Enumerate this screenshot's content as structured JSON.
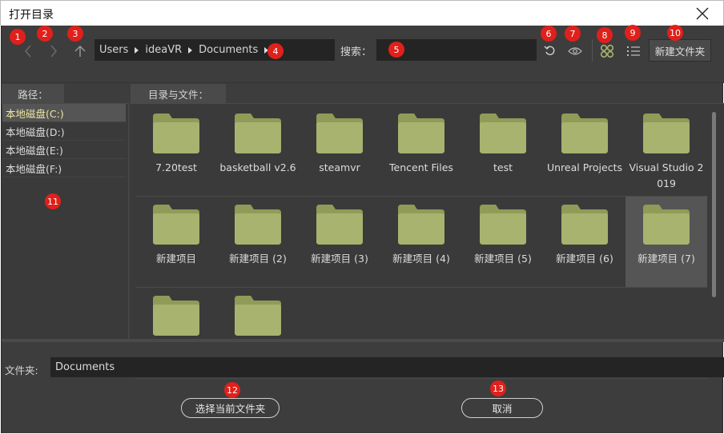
{
  "window": {
    "title": "打开目录"
  },
  "toolbar": {
    "back_icon": "chevron-left-icon",
    "forward_icon": "chevron-right-icon",
    "up_icon": "arrow-up-icon",
    "breadcrumbs": [
      "Users",
      "ideaVR",
      "Documents"
    ],
    "search_label": "搜索：",
    "search_value": "",
    "new_folder_label": "新建文件夹"
  },
  "paths": {
    "tab_label": "路径：",
    "drives": [
      "本地磁盘(C:)",
      "本地磁盘(D:)",
      "本地磁盘(E:)",
      "本地磁盘(F:)"
    ],
    "selected_index": 0
  },
  "files": {
    "tab_label": "目录与文件：",
    "rows": [
      [
        "7.20test",
        "basketball v2.6",
        "steamvr",
        "Tencent Files",
        "test",
        "Unreal Projects",
        "Visual Studio 2019"
      ],
      [
        "新建项目",
        "新建项目 (2)",
        "新建项目 (3)",
        "新建项目 (4)",
        "新建项目 (5)",
        "新建项目 (6)",
        "新建项目 (7)"
      ],
      [
        "",
        ""
      ]
    ],
    "highlighted": "新建项目 (7)"
  },
  "footer": {
    "folder_label": "文件夹:",
    "folder_value": "Documents",
    "select_button": "选择当前文件夹",
    "cancel_button": "取消"
  },
  "markers": [
    "1",
    "2",
    "3",
    "4",
    "5",
    "6",
    "7",
    "8",
    "9",
    "10",
    "11",
    "12",
    "13"
  ],
  "colors": {
    "folder": "#a7b36e",
    "folder_dark": "#8f9b57",
    "marker": "#e0201b",
    "background": "#3d3d3d",
    "field": "#242424",
    "selected_drive_text": "#ece6a0"
  }
}
